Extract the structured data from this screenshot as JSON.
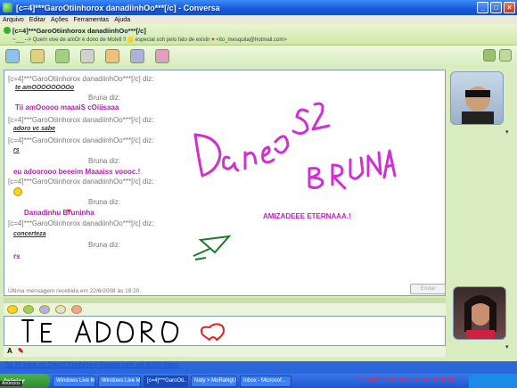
{
  "window": {
    "title": "[c=4]***GaroOtiinhorox danadiinhOo***[/c] - Conversa"
  },
  "menu": [
    "Arquivo",
    "Editar",
    "Ações",
    "Ferramentas",
    "Ajuda"
  ],
  "header": {
    "contact_name": "[c=4]***GaroOtiinhorox danadiinhOo***[/c]",
    "personal_message_a": "~___--> Quem vive de amOr é dono de Motell !!",
    "personal_message_b": "especial soh pelo fato de existir",
    "email": "<ito_mesquita@hotmail.com>"
  },
  "conversation": [
    {
      "type": "header",
      "text": "[c=4]***GaroOtiinhorox danadiinhOo***[/c] diz:"
    },
    {
      "type": "msg-dk",
      "text": "te amOOOOOOOOo"
    },
    {
      "type": "says",
      "text": "Bruna diz:"
    },
    {
      "type": "msg-purple",
      "text": "Tii amOoooo maaaiS cOiiisaaa"
    },
    {
      "type": "header",
      "text": "[c=4]***GaroOtiinhorox danadiinhOo***[/c] diz:"
    },
    {
      "type": "msg-dk",
      "text": "adoro vc sabe"
    },
    {
      "type": "header",
      "text": "[c=4]***GaroOtiinhorox danadiinhOo***[/c] diz:"
    },
    {
      "type": "msg-dk",
      "text": "rs"
    },
    {
      "type": "says",
      "text": "Bruna diz:"
    },
    {
      "type": "msg-purple",
      "text": "eu adoorooo beeeim Maaaiss voooc.!"
    },
    {
      "type": "header",
      "text": "[c=4]***GaroOtiinhorox danadiinhOo***[/c] diz:"
    },
    {
      "type": "says",
      "text": "Bruna diz:"
    },
    {
      "type": "msg-purple",
      "text": "Danadinhu   Bruninha"
    },
    {
      "type": "header",
      "text": "[c=4]***GaroOtiinhorox danadiinhOo***[/c] diz:"
    },
    {
      "type": "msg-dk",
      "text": "concerteza"
    },
    {
      "type": "says",
      "text": "Bruna diz:"
    },
    {
      "type": "msg-purple",
      "text": "rs"
    }
  ],
  "last_message": "Última mensagem recebida em 22/6/2008 às 18:20.",
  "ink_text": {
    "handwriting": "AMIZADEEE ETERNAAA.!"
  },
  "input": {
    "send_label": "Enviar"
  },
  "ad_link": "Só 50 fotos no Orkut? Conheça o Spaces com até 6.000 fotos!",
  "taskbar": {
    "start_label": "Iniciar",
    "ads_label": "Anúncios",
    "tasks": [
      "Windows Live Mes...",
      "Windows Live Mes...",
      "[c=4]***GaroOti...",
      "Naty > MoRaNgUi...",
      "Inbox - Microsof..."
    ],
    "signature": "GaroOtiinhorox danadiinho"
  }
}
